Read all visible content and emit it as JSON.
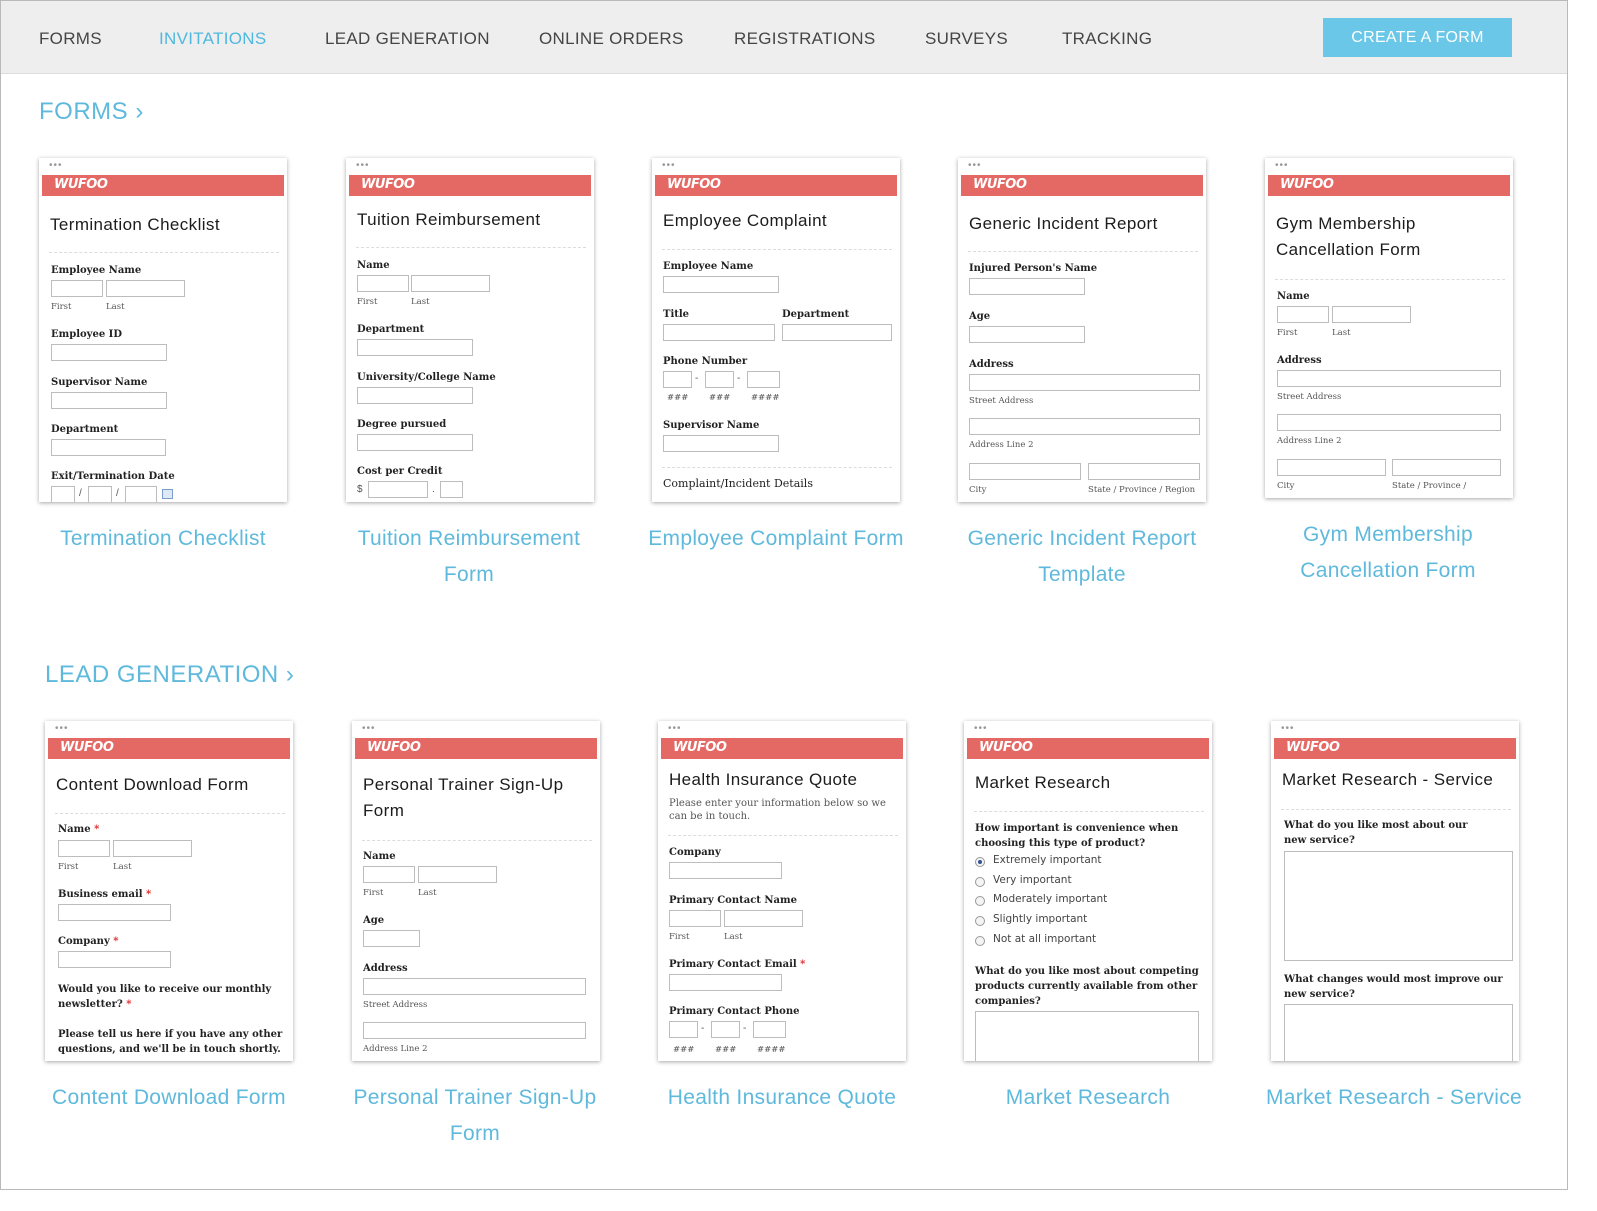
{
  "nav": {
    "items": [
      "FORMS",
      "INVITATIONS",
      "LEAD GENERATION",
      "ONLINE ORDERS",
      "REGISTRATIONS",
      "SURVEYS",
      "TRACKING"
    ],
    "active": "INVITATIONS",
    "create_label": "CREATE A FORM"
  },
  "colors": {
    "accent": "#5fb9dc",
    "button": "#6ac7e7",
    "brand_bar": "#e46864",
    "nav_bg": "#eeeeee"
  },
  "sections": {
    "forms": {
      "title": "FORMS ›",
      "templates": [
        {
          "logo": "WUFOO",
          "thumb_title": "Termination Checklist",
          "fields": {
            "employee_name": "Employee Name",
            "first": "First",
            "last": "Last",
            "employee_id": "Employee ID",
            "supervisor_name": "Supervisor Name",
            "department": "Department",
            "exit_date": "Exit/Termination Date",
            "slash": "/"
          },
          "caption": "Termination Checklist"
        },
        {
          "logo": "WUFOO",
          "thumb_title": "Tuition Reimbursement",
          "fields": {
            "name": "Name",
            "first": "First",
            "last": "Last",
            "department": "Department",
            "university": "University/College Name",
            "degree": "Degree pursued",
            "cost": "Cost per Credit",
            "dollar": "$",
            "dot": "."
          },
          "caption": "Tuition Reimbursement Form"
        },
        {
          "logo": "WUFOO",
          "thumb_title": "Employee Complaint",
          "fields": {
            "employee_name": "Employee Name",
            "title": "Title",
            "department": "Department",
            "phone": "Phone Number",
            "dash": "-",
            "p1": "###",
            "p2": "###",
            "p3": "####",
            "supervisor_name": "Supervisor Name",
            "details": "Complaint/Incident Details"
          },
          "caption": "Employee Complaint Form"
        },
        {
          "logo": "WUFOO",
          "thumb_title": "Generic Incident Report",
          "fields": {
            "injured_name": "Injured Person's Name",
            "age": "Age",
            "address": "Address",
            "street": "Street Address",
            "line2": "Address Line 2",
            "city": "City",
            "state": "State / Province / Region"
          },
          "caption": "Generic Incident Report Template"
        },
        {
          "logo": "WUFOO",
          "thumb_title": "Gym Membership Cancellation Form",
          "fields": {
            "name": "Name",
            "first": "First",
            "last": "Last",
            "address": "Address",
            "street": "Street Address",
            "line2": "Address Line 2",
            "city": "City",
            "state": "State / Province /"
          },
          "caption": "Gym Membership Cancellation Form"
        }
      ]
    },
    "lead_generation": {
      "title": "LEAD GENERATION ›",
      "templates": [
        {
          "logo": "WUFOO",
          "thumb_title": "Content Download Form",
          "fields": {
            "name": "Name",
            "first": "First",
            "last": "Last",
            "req": "*",
            "business_email": "Business email",
            "company": "Company",
            "newsletter": "Would you like to receive our monthly newsletter?",
            "tell_us": "Please tell us here if you have any other questions, and we'll be in touch shortly."
          },
          "caption": "Content Download Form"
        },
        {
          "logo": "WUFOO",
          "thumb_title": "Personal Trainer Sign-Up Form",
          "fields": {
            "name": "Name",
            "first": "First",
            "last": "Last",
            "age": "Age",
            "address": "Address",
            "street": "Street Address",
            "line2": "Address Line 2"
          },
          "caption": "Personal Trainer Sign-Up Form"
        },
        {
          "logo": "WUFOO",
          "thumb_title": "Health Insurance Quote",
          "description": "Please enter your information below so we can be in touch.",
          "fields": {
            "company": "Company",
            "contact_name": "Primary Contact Name",
            "first": "First",
            "last": "Last",
            "contact_email": "Primary Contact Email",
            "req": "*",
            "contact_phone": "Primary Contact Phone",
            "dash": "-",
            "p1": "###",
            "p2": "###",
            "p3": "####"
          },
          "caption": "Health Insurance Quote"
        },
        {
          "logo": "WUFOO",
          "thumb_title": "Market Research",
          "fields": {
            "q1": "How important is convenience when choosing this type of product?",
            "options": [
              "Extremely important",
              "Very important",
              "Moderately important",
              "Slightly important",
              "Not at all important"
            ],
            "selected": "Extremely important",
            "q2": "What do you like most about competing products currently available from other companies?"
          },
          "caption": "Market Research"
        },
        {
          "logo": "WUFOO",
          "thumb_title": "Market Research - Service",
          "fields": {
            "q1": "What do you like most about our new service?",
            "q2": "What changes would most improve our new service?"
          },
          "caption": "Market Research - Service"
        }
      ]
    }
  }
}
